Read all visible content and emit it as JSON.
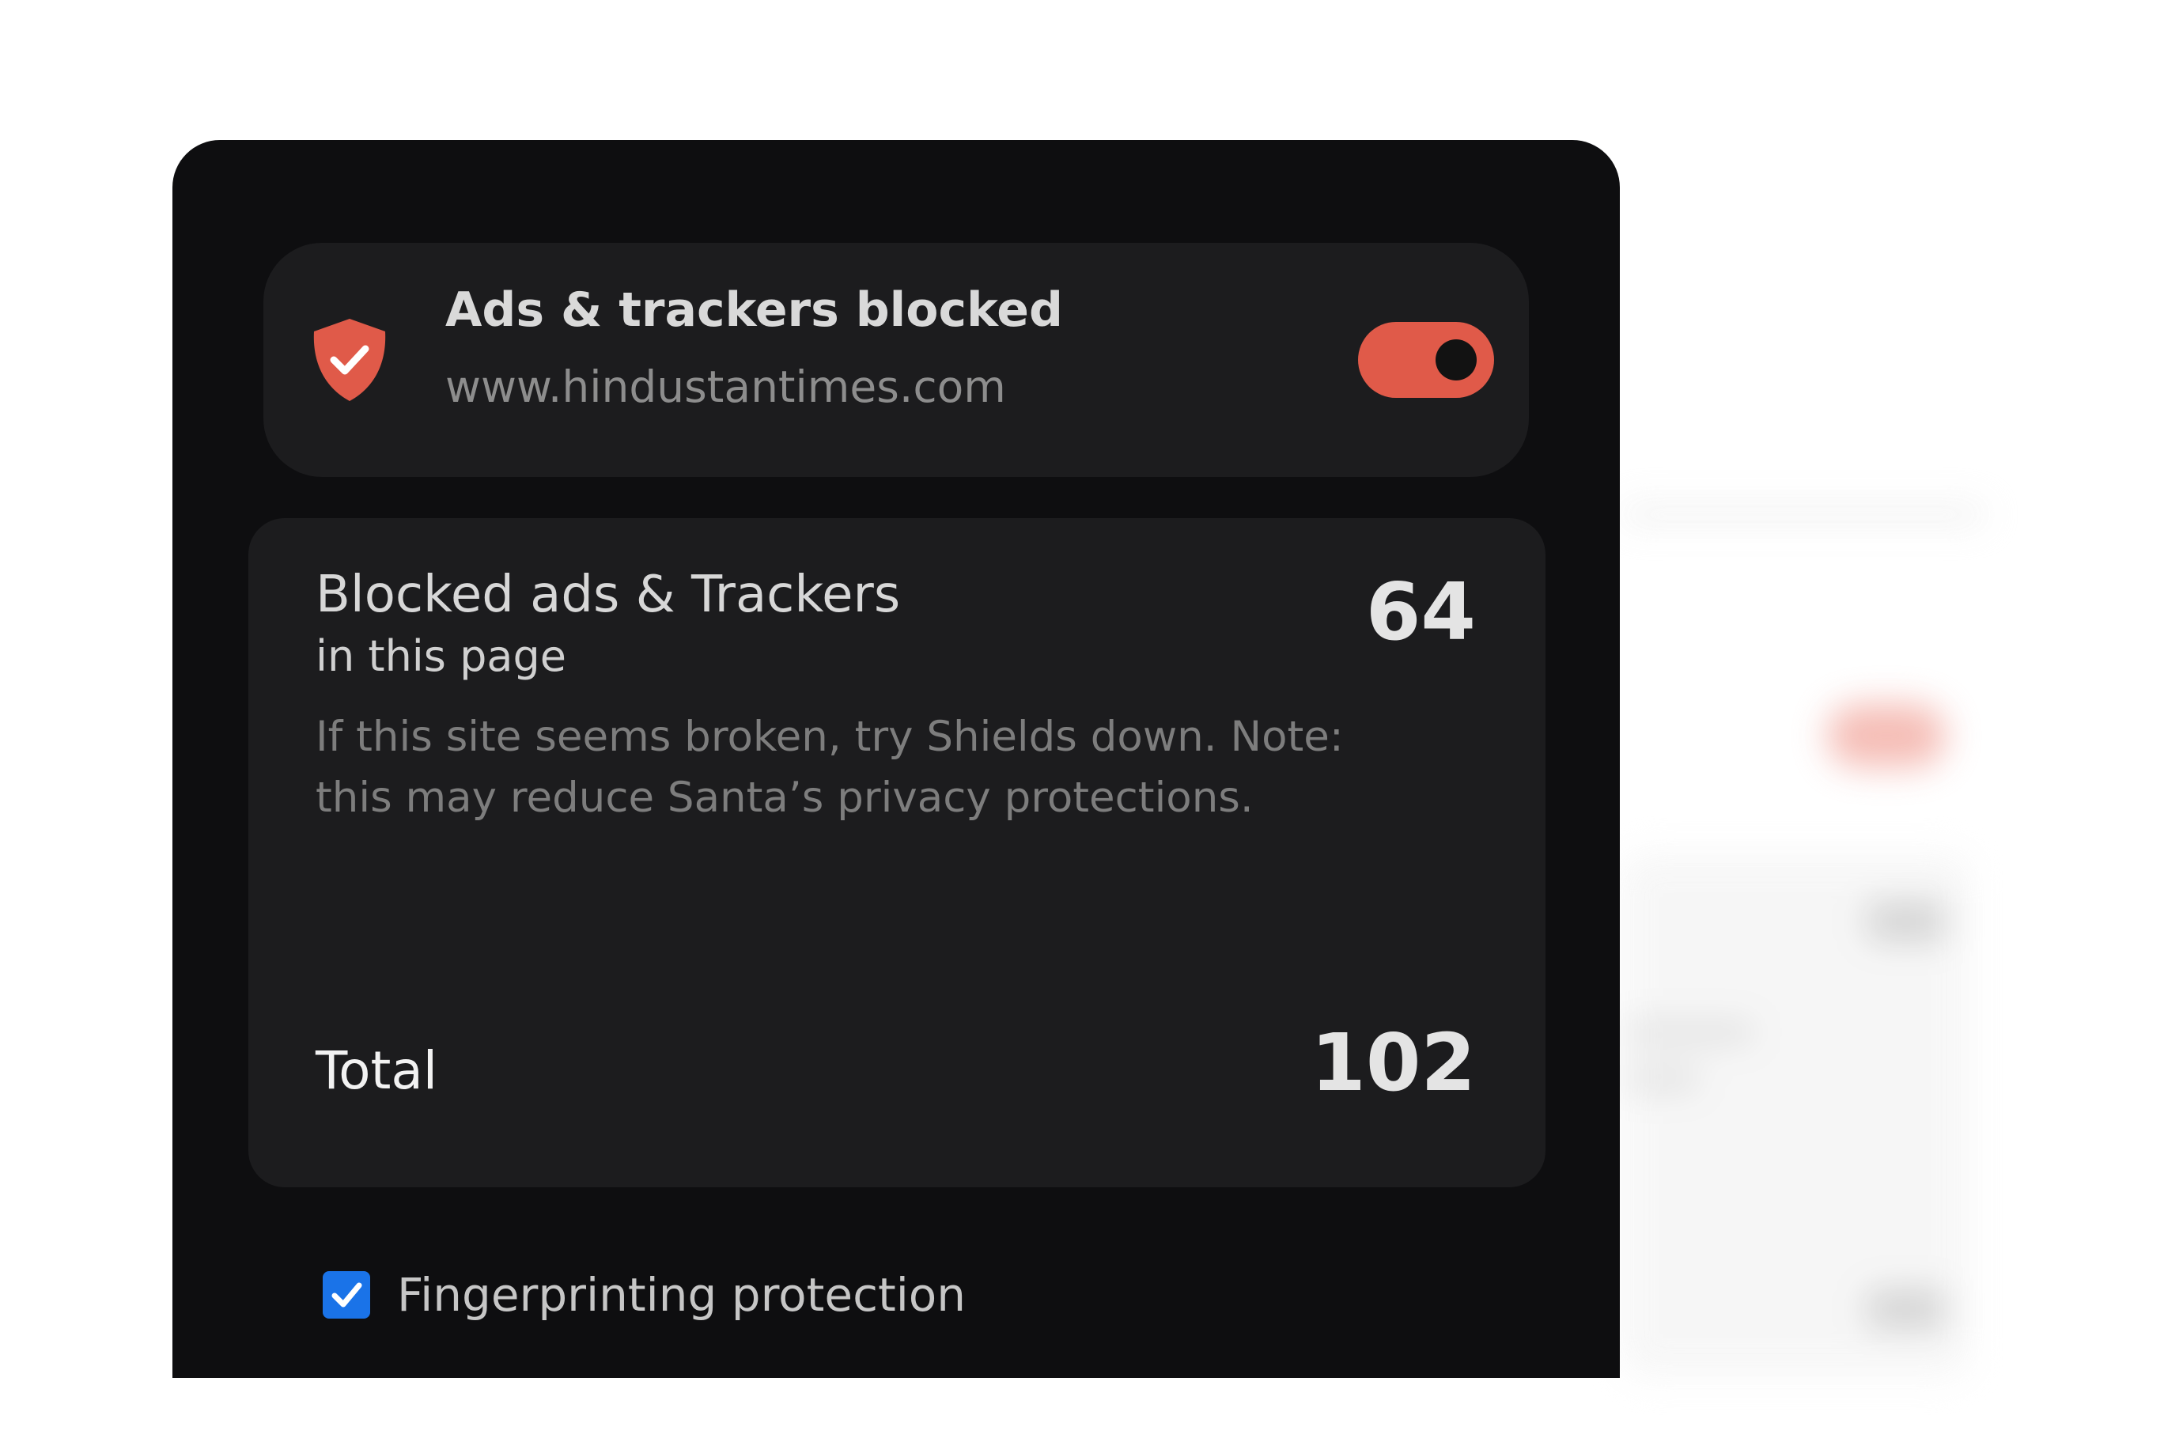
{
  "shield": {
    "title": "Ads & trackers blocked",
    "url": "www.hindustantimes.com",
    "toggle_on": true,
    "accent_color": "#e05a49",
    "icon": "shield-check-icon"
  },
  "stats": {
    "heading": "Blocked ads & Trackers",
    "subheading": "in this page",
    "page_count": "64",
    "note": "If this site seems broken, try Shields down. Note: this may reduce Santa’s privacy protections.",
    "total_label": "Total",
    "total_count": "102"
  },
  "fingerprinting": {
    "label": "Fingerprinting protection",
    "checked": true,
    "checkbox_color": "#1a73e8"
  }
}
